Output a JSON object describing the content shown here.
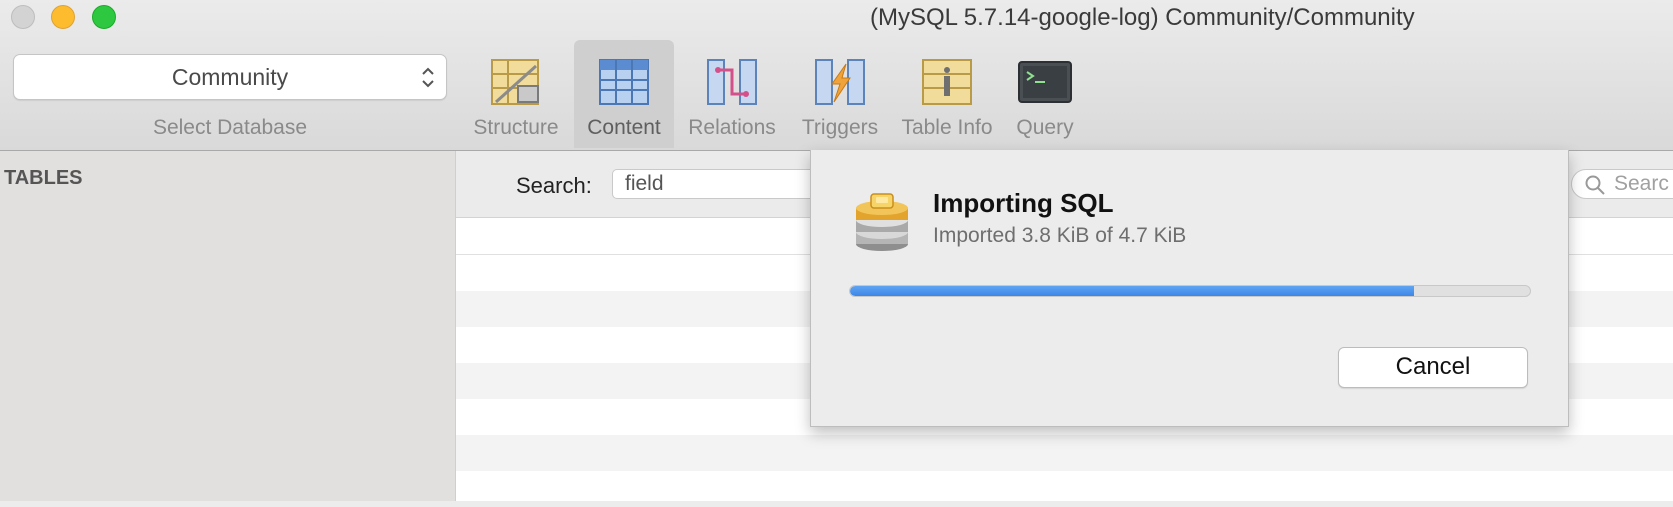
{
  "window": {
    "title": "(MySQL 5.7.14-google-log) Community/Community"
  },
  "toolbar": {
    "database_select": {
      "value": "Community",
      "label": "Select Database"
    },
    "tools": [
      {
        "label": "Structure",
        "icon": "structure-icon",
        "active": false
      },
      {
        "label": "Content",
        "icon": "content-icon",
        "active": true
      },
      {
        "label": "Relations",
        "icon": "relations-icon",
        "active": false
      },
      {
        "label": "Triggers",
        "icon": "triggers-icon",
        "active": false
      },
      {
        "label": "Table Info",
        "icon": "table-info-icon",
        "active": false
      },
      {
        "label": "Query",
        "icon": "query-icon",
        "active": false
      }
    ]
  },
  "sidebar": {
    "header": "TABLES"
  },
  "content": {
    "search_label": "Search:",
    "field_value": "field",
    "search_placeholder": "Searc"
  },
  "dialog": {
    "title": "Importing SQL",
    "status": "Imported 3.8 KiB of 4.7 KiB",
    "progress_fraction": 0.83,
    "cancel_label": "Cancel",
    "accent_color": "#3d86e7"
  }
}
